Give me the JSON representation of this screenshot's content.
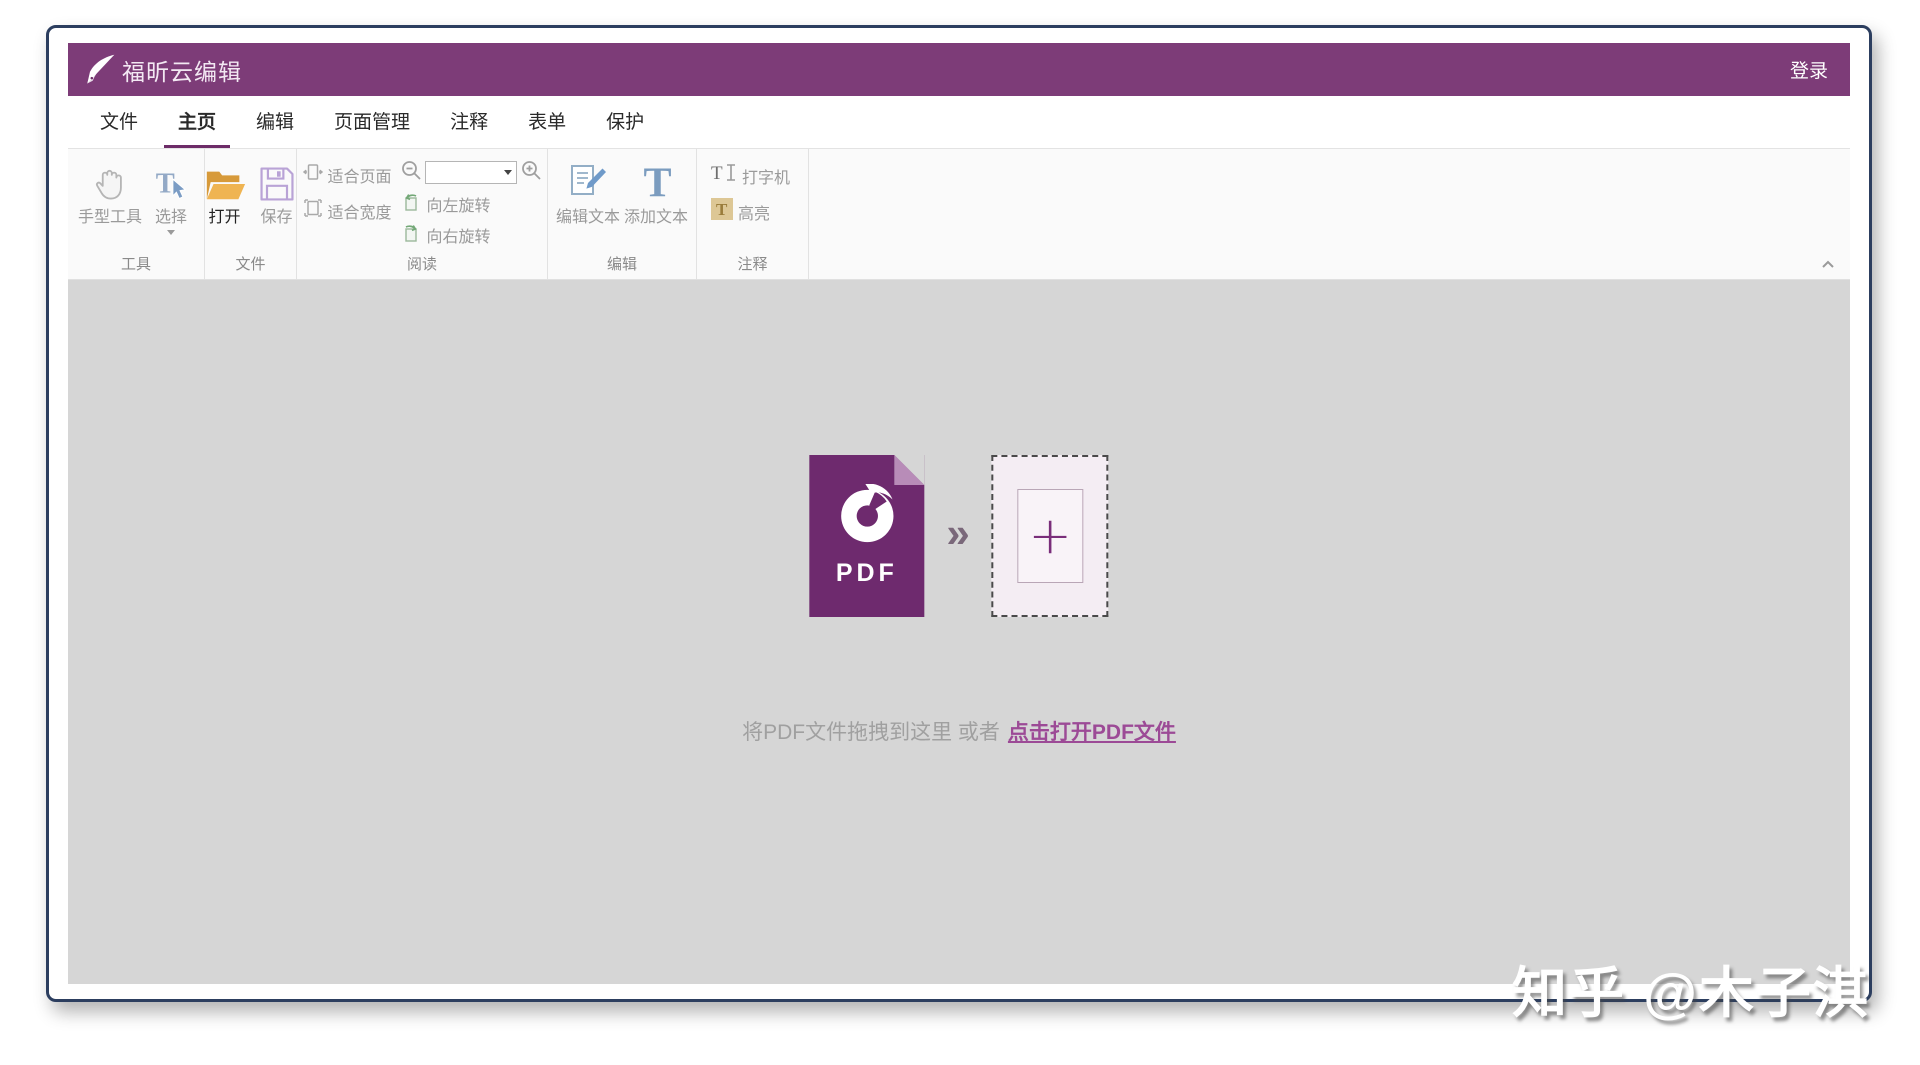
{
  "app": {
    "title": "福昕云编辑",
    "login_label": "登录"
  },
  "tabs": [
    {
      "label": "文件"
    },
    {
      "label": "主页",
      "active": true
    },
    {
      "label": "编辑"
    },
    {
      "label": "页面管理"
    },
    {
      "label": "注释"
    },
    {
      "label": "表单"
    },
    {
      "label": "保护"
    }
  ],
  "ribbon": {
    "zoom_value": "",
    "groups": {
      "tools": {
        "label": "工具",
        "hand_tool": "手型工具",
        "select": "选择"
      },
      "file": {
        "label": "文件",
        "open": "打开",
        "save": "保存"
      },
      "read": {
        "label": "阅读",
        "fit_page": "适合页面",
        "fit_width": "适合宽度",
        "rotate_left": "向左旋转",
        "rotate_right": "向右旋转"
      },
      "edit": {
        "label": "编辑",
        "edit_text": "编辑文本",
        "add_text": "添加文本"
      },
      "comment": {
        "label": "注释",
        "typewriter": "打字机",
        "highlight": "高亮"
      }
    }
  },
  "canvas": {
    "pdf_icon_label": "PDF",
    "drop_hint": "将PDF文件拖拽到这里 或者",
    "open_link": "点击打开PDF文件"
  },
  "icons": {
    "chevron_double": "»",
    "plus": "+"
  },
  "watermark": "知乎 @木子淇",
  "colors": {
    "brand_purple": "#7d3c78",
    "pdf_purple": "#6e2a6e",
    "link_purple": "#9c4a96",
    "canvas_gray": "#d6d6d6",
    "window_border": "#2c3e5f"
  }
}
